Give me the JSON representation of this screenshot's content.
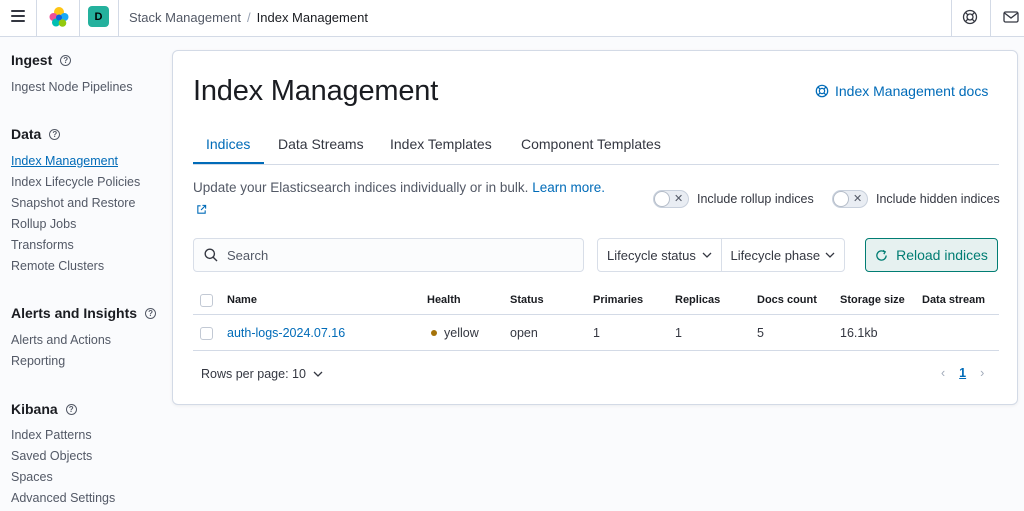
{
  "header": {
    "space_initial": "D",
    "breadcrumbs": [
      "Stack Management",
      "Index Management"
    ],
    "separator": "/"
  },
  "sidebar": {
    "sections": [
      {
        "title": "Ingest",
        "items": [
          "Ingest Node Pipelines"
        ]
      },
      {
        "title": "Data",
        "items": [
          "Index Management",
          "Index Lifecycle Policies",
          "Snapshot and Restore",
          "Rollup Jobs",
          "Transforms",
          "Remote Clusters"
        ]
      },
      {
        "title": "Alerts and Insights",
        "items": [
          "Alerts and Actions",
          "Reporting"
        ]
      },
      {
        "title": "Kibana",
        "items": [
          "Index Patterns",
          "Saved Objects",
          "Spaces",
          "Advanced Settings"
        ]
      }
    ],
    "help_glyph": "?"
  },
  "main": {
    "title": "Index Management",
    "docs_link": "Index Management docs",
    "tabs": [
      "Indices",
      "Data Streams",
      "Index Templates",
      "Component Templates"
    ],
    "description": "Update your Elasticsearch indices individually or in bulk.",
    "learn_more": "Learn more.",
    "toggles": [
      {
        "label": "Include rollup indices",
        "checked": false
      },
      {
        "label": "Include hidden indices",
        "checked": false
      }
    ],
    "toggle_off_glyph": "✕",
    "search_placeholder": "Search",
    "filters": [
      "Lifecycle status",
      "Lifecycle phase"
    ],
    "reload_button": "Reload indices",
    "table": {
      "columns": [
        "Name",
        "Health",
        "Status",
        "Primaries",
        "Replicas",
        "Docs count",
        "Storage size",
        "Data stream"
      ],
      "rows": [
        {
          "name": "auth-logs-2024.07.16",
          "health": "yellow",
          "status": "open",
          "primaries": "1",
          "replicas": "1",
          "docs_count": "5",
          "storage_size": "16.1kb",
          "data_stream": ""
        }
      ]
    },
    "rows_per_page": "Rows per page: 10",
    "pagination": {
      "current_page": "1",
      "prev": "‹",
      "next": "›"
    }
  },
  "colors": {
    "accent": "#006bb8",
    "reload": "#017d73",
    "health_yellow": "#a5730a",
    "space_avatar": "#24b19d"
  },
  "icons": [
    "menu-icon",
    "elastic-logo",
    "help-icon",
    "mail-icon",
    "lifebuoy-icon",
    "search-icon",
    "chevron-down-icon",
    "refresh-icon",
    "external-link-icon"
  ]
}
